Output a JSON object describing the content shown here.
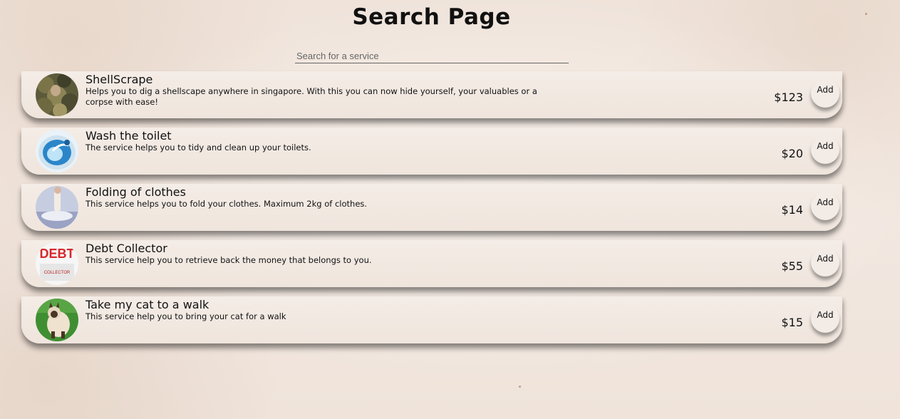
{
  "page": {
    "title": "Search Page"
  },
  "search": {
    "placeholder": "Search for a service",
    "value": ""
  },
  "services": [
    {
      "name": "ShellScrape",
      "description": "Helps you to dig a shellscape anywhere in singapore. With this you can now hide yourself, your valuables or a corpse with ease!",
      "price": "$123",
      "add_label": "Add",
      "image": "camouflage-soldier-photo"
    },
    {
      "name": "Wash the toilet",
      "description": "The service helps you to tidy and clean up your toilets.",
      "price": "$20",
      "add_label": "Add",
      "image": "toilet-bowl-photo"
    },
    {
      "name": "Folding of clothes",
      "description": "This service helps you to fold your clothes. Maximum 2kg of clothes.",
      "price": "$14",
      "add_label": "Add",
      "image": "folding-clothes-photo"
    },
    {
      "name": "Debt Collector",
      "description": "This service help you to retrieve back the money that belongs to you.",
      "price": "$55",
      "add_label": "Add",
      "image": "debt-collector-logo",
      "image_text": "DEBT",
      "image_subtext": "COLLECTOR"
    },
    {
      "name": "Take my cat to a walk",
      "description": "This service help you to bring your cat for a walk",
      "price": "$15",
      "add_label": "Add",
      "image": "siamese-cat-photo"
    }
  ],
  "colors": {
    "background": "#efe3da",
    "card": "#f4ece6",
    "text": "#111111"
  }
}
